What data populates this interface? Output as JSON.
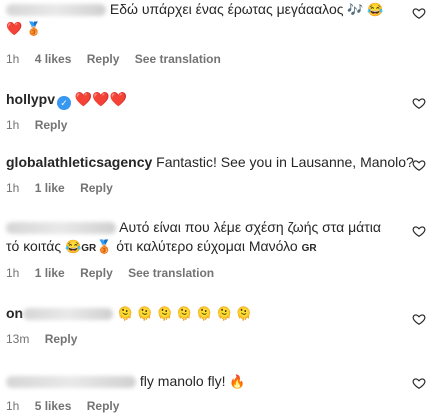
{
  "comments": [
    {
      "user_visible": "",
      "text": "Εδώ υπάρχει ένας έρωτας μεγάααλος",
      "emoji_tail": "🎶 😂",
      "emoji_line2": "❤️ 🥉",
      "time": "1h",
      "likes": "4 likes",
      "reply": "Reply",
      "translation": "See translation"
    },
    {
      "user": "hollypv",
      "verified_icon": "verified-badge-icon",
      "text": "❤️❤️❤️",
      "time": "1h",
      "reply": "Reply"
    },
    {
      "user": "globalathleticsagency",
      "text": "Fantastic! See you in Lausanne, Manolo?",
      "time": "1h",
      "likes": "1 like",
      "reply": "Reply"
    },
    {
      "user_visible": "",
      "text": "Αυτό είναι που λέμε σχέση ζωής στα μάτια",
      "text2_a": "τό κοιτάς",
      "text2_b": "ότι καλύτερο εύχομαι Μανόλο",
      "gr": "GR",
      "time": "1h",
      "likes": "1 like",
      "reply": "Reply",
      "translation": "See translation"
    },
    {
      "user_visible": "on",
      "text": "🫠 🫠 🫠 🫠 🫠 🫠 🫠",
      "time": "13m",
      "reply": "Reply"
    },
    {
      "user_visible": "",
      "text": "fly manolo fly!",
      "emoji_tail": "🔥",
      "time": "1h",
      "likes": "5 likes",
      "reply": "Reply"
    }
  ],
  "icons": {
    "like": "heart-outline-icon"
  }
}
